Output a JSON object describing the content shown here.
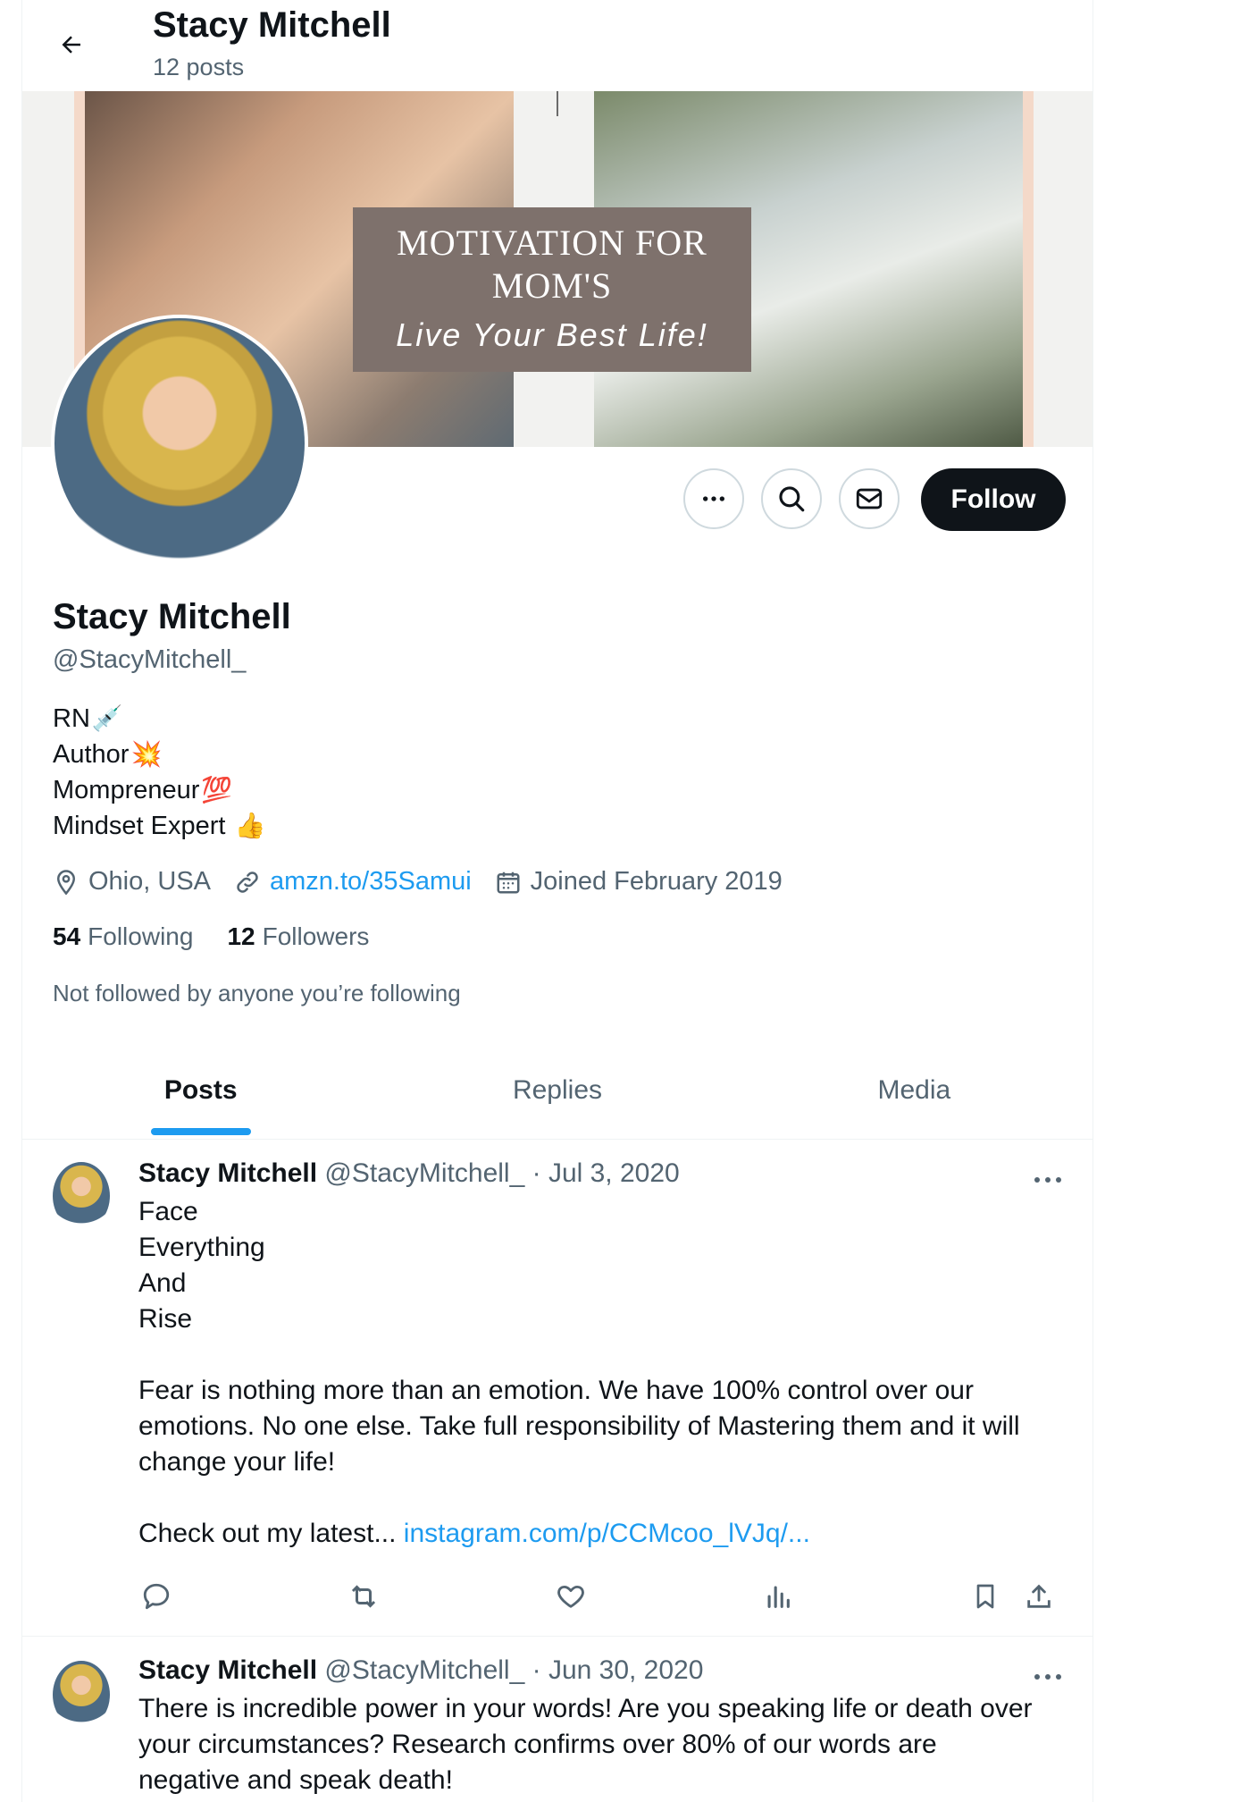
{
  "header": {
    "name": "Stacy Mitchell",
    "posts_count": "12 posts"
  },
  "banner": {
    "title_line1": "MOTIVATION FOR",
    "title_line2": "MOM'S",
    "subtitle": "Live Your Best Life!"
  },
  "actions": {
    "follow_label": "Follow"
  },
  "profile": {
    "display_name": "Stacy Mitchell",
    "handle": "@StacyMitchell_",
    "bio": [
      {
        "text": "RN",
        "emoji": "💉"
      },
      {
        "text": "Author",
        "emoji": "💥"
      },
      {
        "text": "Mompreneur",
        "emoji": "💯"
      },
      {
        "text": "Mindset Expert ",
        "emoji": "👍"
      }
    ],
    "location": "Ohio, USA",
    "website": "amzn.to/35Samui",
    "joined": "Joined February 2019",
    "following_count": "54",
    "following_label": "Following",
    "followers_count": "12",
    "followers_label": "Followers",
    "not_followed": "Not followed by anyone you’re following"
  },
  "tabs": [
    {
      "label": "Posts"
    },
    {
      "label": "Replies"
    },
    {
      "label": "Media"
    }
  ],
  "posts": [
    {
      "name": "Stacy Mitchell",
      "meta": "@StacyMitchell_ · Jul 3, 2020",
      "lines": [
        "Face",
        "Everything",
        "And",
        "Rise",
        "",
        "Fear is nothing more than an emotion. We have 100% control over our",
        "emotions. No one else. Take full responsibility of Mastering them and it will",
        "change your life!",
        ""
      ],
      "link_prefix": "Check out my latest... ",
      "link": "instagram.com/p/CCMcoo_lVJq/..."
    },
    {
      "name": "Stacy Mitchell",
      "meta": "@StacyMitchell_ · Jun 30, 2020",
      "lines": [
        "There is incredible power in your words! Are you speaking life or death over",
        "your circumstances? Research confirms over 80% of our words are",
        "negative and speak death!"
      ]
    }
  ],
  "colors": {
    "accent": "#1d9bf0",
    "text": "#0f1419",
    "muted": "#536471",
    "banner_box": "#7e716c"
  }
}
